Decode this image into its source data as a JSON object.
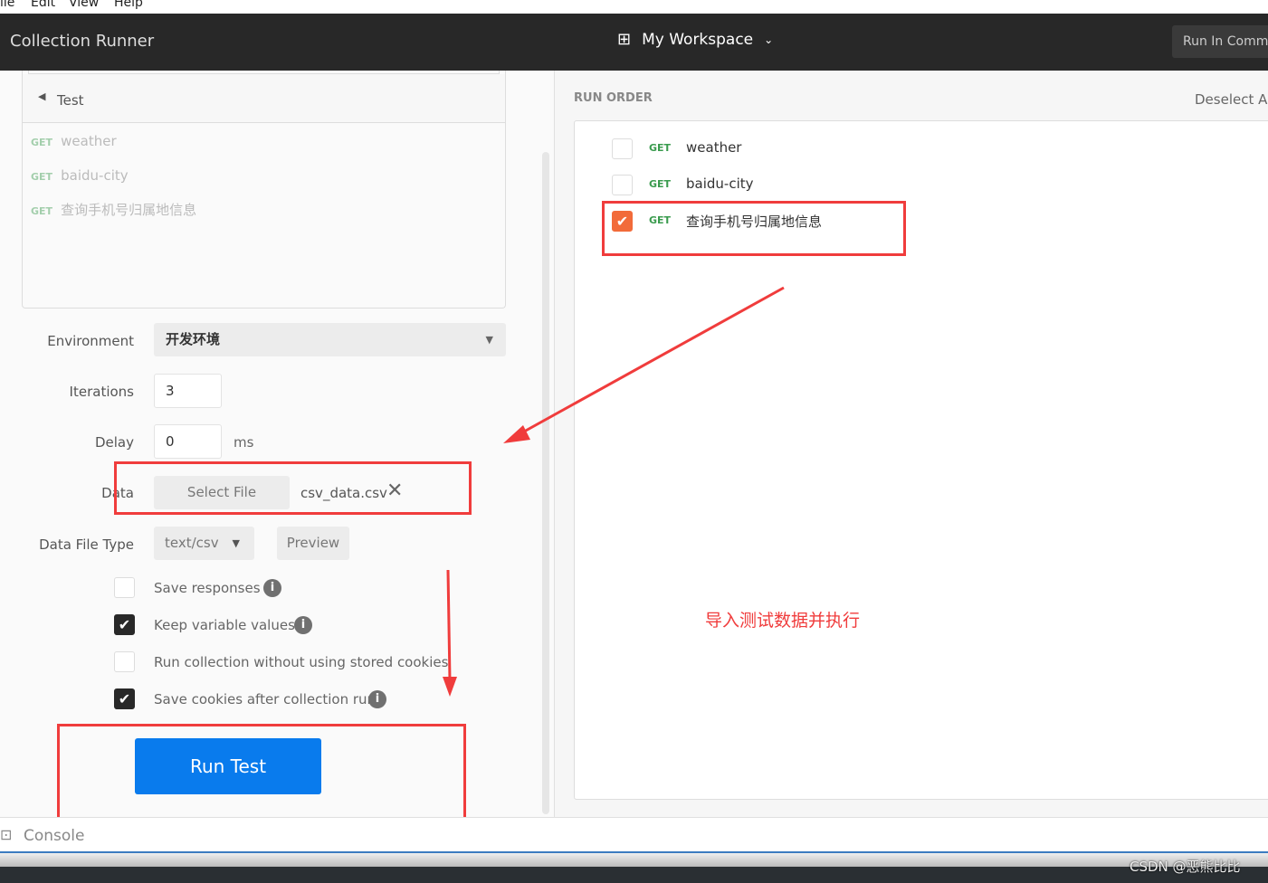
{
  "menubar": {
    "items": [
      "ile",
      "Edit",
      "View",
      "Help"
    ]
  },
  "header": {
    "title": "Collection Runner",
    "workspace": "My Workspace",
    "run_in_command": "Run In Comm"
  },
  "collection": {
    "folder": "Test",
    "requests": [
      {
        "method": "GET",
        "name": "weather"
      },
      {
        "method": "GET",
        "name": "baidu-city"
      },
      {
        "method": "GET",
        "name": "查询手机号归属地信息"
      }
    ]
  },
  "form": {
    "environment_label": "Environment",
    "environment_value": "开发环境",
    "iterations_label": "Iterations",
    "iterations_value": "3",
    "delay_label": "Delay",
    "delay_value": "0",
    "delay_unit": "ms",
    "data_label": "Data",
    "select_file": "Select File",
    "file_name": "csv_data.csv",
    "data_file_type_label": "Data File Type",
    "data_file_type_value": "text/csv",
    "preview": "Preview",
    "options": [
      {
        "label": "Save responses",
        "checked": false,
        "info": true
      },
      {
        "label": "Keep variable values",
        "checked": true,
        "info": true
      },
      {
        "label": "Run collection without using stored cookies",
        "checked": false,
        "info": false
      },
      {
        "label": "Save cookies after collection run",
        "checked": true,
        "info": true
      }
    ],
    "run_button": "Run Test"
  },
  "run_order": {
    "title": "RUN ORDER",
    "deselect_all": "Deselect All",
    "items": [
      {
        "method": "GET",
        "name": "weather",
        "checked": false
      },
      {
        "method": "GET",
        "name": "baidu-city",
        "checked": false
      },
      {
        "method": "GET",
        "name": "查询手机号归属地信息",
        "checked": true
      }
    ]
  },
  "annotation": "导入测试数据并执行",
  "footer": {
    "console": "Console"
  },
  "watermark": "CSDN @恶熊比比",
  "colors": {
    "header": "#282828",
    "run_button": "#097bed",
    "checkbox_orange": "#f26b3a",
    "annotation_red": "#f03c3c",
    "get": "#3a9b4e"
  }
}
